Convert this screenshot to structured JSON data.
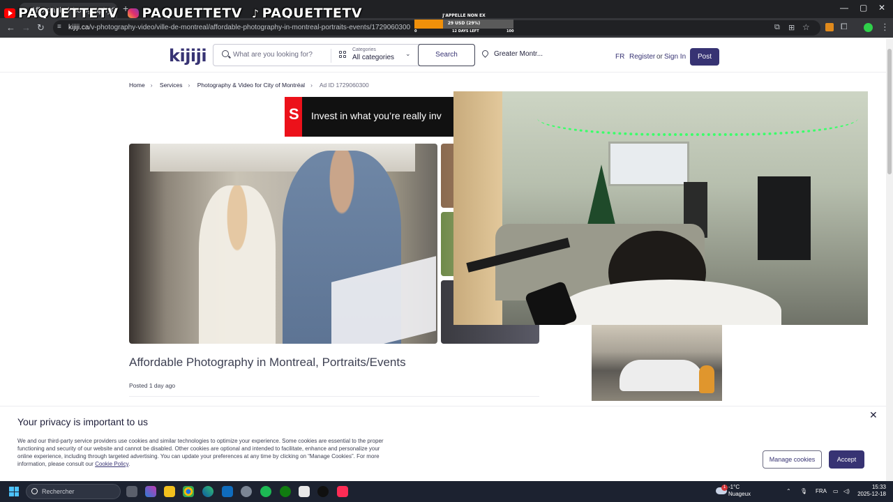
{
  "browser": {
    "tab_title": "Affordable Photography in Mo",
    "url_host": "kijiji.ca",
    "url_path": "/v-photography-video/ville-de-montreal/affordable-photography-in-montreal-portraits-events/1729060300"
  },
  "stream_overlay": {
    "handles": [
      "PAQUETTETV",
      "PAQUETTETV",
      "PAQUETTETV"
    ],
    "goal": {
      "title": "J'APPELLE NON EX",
      "amount": "29 USD (29%)",
      "progress_percent": 29,
      "min": "0",
      "max": "100",
      "days_left": "12 DAYS LEFT"
    }
  },
  "header": {
    "logo": "kijiji",
    "search_placeholder": "What are you looking for?",
    "categories_label": "Categories",
    "categories_value": "All categories",
    "search_button": "Search",
    "location": "Greater Montr...",
    "lang": "FR",
    "register": "Register",
    "or": "or",
    "sign_in": "Sign In",
    "post": "Post"
  },
  "breadcrumb": [
    "Home",
    "Services",
    "Photography & Video for City of Montréal",
    "Ad ID 1729060300"
  ],
  "ad_banner": {
    "text": "Invest in what you’re really inv"
  },
  "listing": {
    "title": "Affordable Photography in Montreal, Portraits/Events",
    "posted": "Posted 1 day ago"
  },
  "cookie_banner": {
    "heading": "Your privacy is important to us",
    "body": "We and our third-party service providers use cookies and similar technologies to optimize your experience. Some cookies are essential to the proper functioning and security of our website and cannot be disabled. Other cookies are optional and intended to facilitate, enhance and personalize your online experience, including through targeted advertising. You can update your preferences at any time by clicking on “Manage Cookies”. For more information, please consult our",
    "link": "Cookie Policy",
    "manage": "Manage cookies",
    "accept": "Accept"
  },
  "taskbar": {
    "search": "Rechercher",
    "weather_temp": "-1°C",
    "weather_desc": "Nuageux",
    "lang": "FRA",
    "time": "15:33",
    "date": "2025-12-18",
    "notification_count": "1"
  }
}
